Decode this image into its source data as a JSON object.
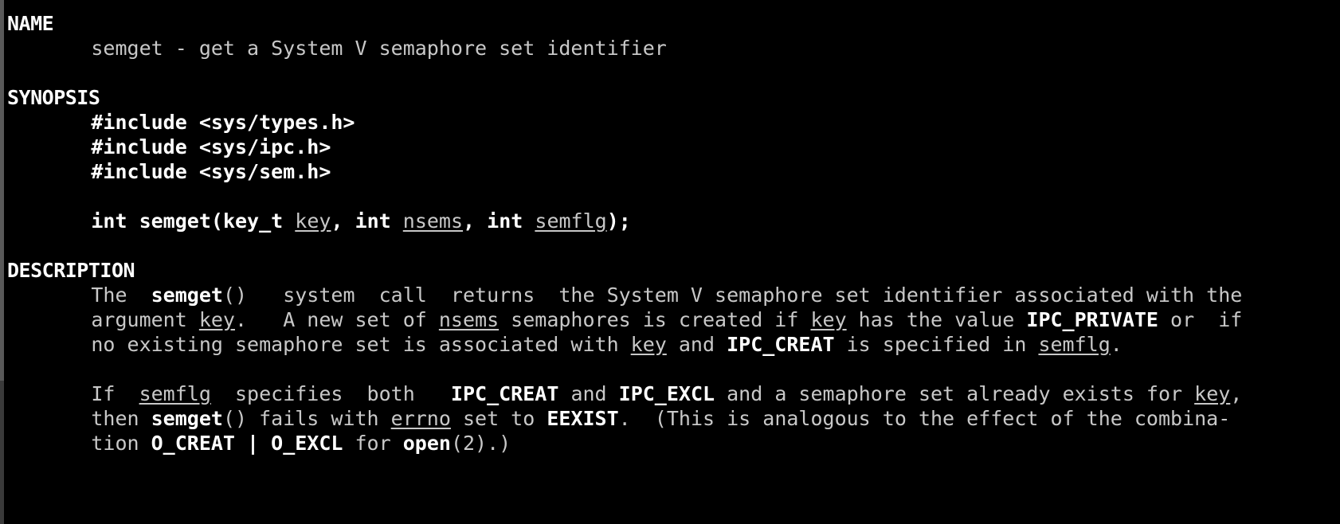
{
  "terminal": {
    "background_color": "#000000",
    "text_color": "#c8c8c8",
    "bold_color": "#ffffff",
    "scrollbar_track_color": "#3a3a3a",
    "scrollbar_thumb_color": "#595959"
  },
  "manpage": {
    "name_heading": "NAME",
    "name_line": "semget - get a System V semaphore set identifier",
    "synopsis_heading": "SYNOPSIS",
    "include_types": "#include <sys/types.h>",
    "include_ipc": "#include <sys/ipc.h>",
    "include_sem": "#include <sys/sem.h>",
    "proto": {
      "int1": "int",
      "func": "semget",
      "open_paren": "(",
      "keyt": "key_t",
      "arg_key": "key",
      "comma1": ",",
      "int2": "int",
      "arg_nsems": "nsems",
      "comma2": ",",
      "int3": "int",
      "arg_semflg": "semflg",
      "close_paren": ");"
    },
    "description_heading": "DESCRIPTION",
    "para1": {
      "l1_a": "The",
      "l1_func": "semget",
      "l1_b": "()   system  call  returns  the System V semaphore set identifier associated with the",
      "l2_a": "argument ",
      "l2_key": "key",
      "l2_b": ".   A new set of ",
      "l2_nsems": "nsems",
      "l2_c": " semaphores is created if ",
      "l2_key2": "key",
      "l2_d": " has the value ",
      "l2_ipcprivate": "IPC_PRIVATE",
      "l2_e": " or  if",
      "l3_a": "no existing semaphore set is associated with ",
      "l3_key": "key",
      "l3_b": " and ",
      "l3_ipccreat": "IPC_CREAT",
      "l3_c": " is specified in ",
      "l3_semflg": "semflg",
      "l3_d": "."
    },
    "para2": {
      "l1_a": "If  ",
      "l1_semflg": "semflg",
      "l1_b": "  specifies  both   ",
      "l1_ipccreat": "IPC_CREAT",
      "l1_c": " and ",
      "l1_ipcexcl": "IPC_EXCL",
      "l1_d": " and a semaphore set already exists for ",
      "l1_key": "key",
      "l1_e": ",",
      "l2_a": "then ",
      "l2_func": "semget",
      "l2_b": "() fails with ",
      "l2_errno": "errno",
      "l2_c": " set to ",
      "l2_eexist": "EEXIST",
      "l2_d": ".  (This is analogous to the effect of the combina-",
      "l3_a": "tion ",
      "l3_ocreat": "O_CREAT",
      "l3_pipe": " | ",
      "l3_oexcl": "O_EXCL",
      "l3_b": " for ",
      "l3_open": "open",
      "l3_c": "(2).)"
    }
  }
}
